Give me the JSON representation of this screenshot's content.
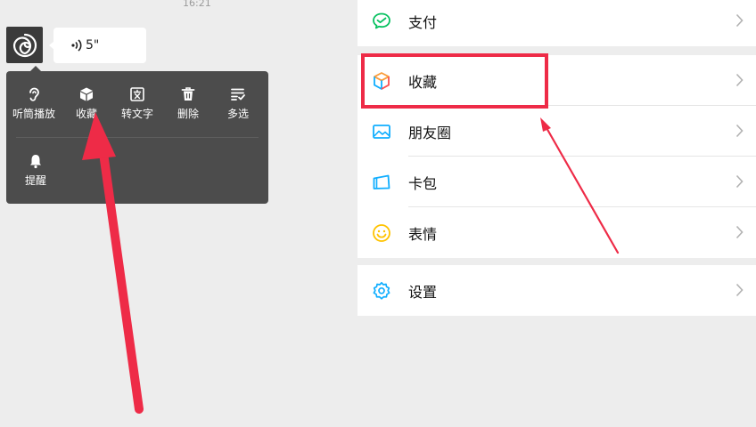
{
  "status_bar": {
    "time": "16:21"
  },
  "chat": {
    "voice_duration": "5\""
  },
  "context_menu": {
    "items": [
      {
        "label": "听筒播放",
        "icon": "ear-icon"
      },
      {
        "label": "收藏",
        "icon": "cube-icon"
      },
      {
        "label": "转文字",
        "icon": "text-convert-icon"
      },
      {
        "label": "删除",
        "icon": "trash-icon"
      },
      {
        "label": "多选",
        "icon": "multi-select-icon"
      },
      {
        "label": "提醒",
        "icon": "bell-icon"
      }
    ]
  },
  "settings_list": {
    "items": [
      {
        "label": "支付",
        "icon": "pay-icon",
        "color": "#07c160"
      },
      {
        "label": "收藏",
        "icon": "favorites-cube-icon",
        "color": "#fa9d3b"
      },
      {
        "label": "朋友圈",
        "icon": "moments-photo-icon",
        "color": "#10aeff"
      },
      {
        "label": "卡包",
        "icon": "card-wallet-icon",
        "color": "#10aeff"
      },
      {
        "label": "表情",
        "icon": "smiley-icon",
        "color": "#ffc300"
      },
      {
        "label": "设置",
        "icon": "gear-icon",
        "color": "#10aeff"
      }
    ]
  },
  "annotation": {
    "highlight_color": "#ee2b47"
  }
}
